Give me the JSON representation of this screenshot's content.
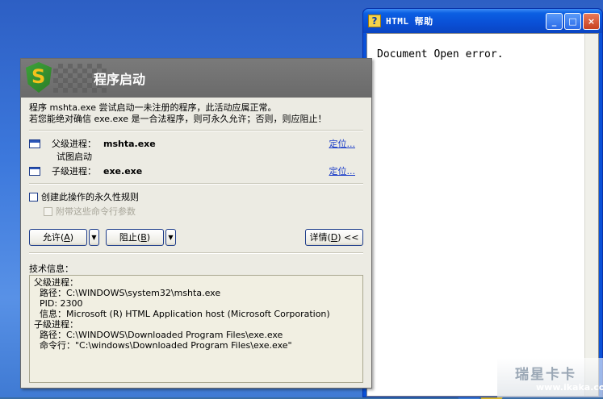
{
  "help_window": {
    "title": "HTML 帮助",
    "icon_glyph": "?",
    "body_text": "Document Open error.",
    "buttons": {
      "minimize": "_",
      "maximize": "□",
      "close": "×"
    }
  },
  "dialog": {
    "title": "程序启动",
    "desc_line1": "程序 mshta.exe 尝试启动一未注册的程序，此活动应属正常。",
    "desc_line2": "若您能绝对确信 exe.exe 是一合法程序，则可永久允许；否则，则应阻止！",
    "parent_label": "父级进程：",
    "parent_name": "mshta.exe",
    "tried_text": "试图启动",
    "child_label": "子级进程：",
    "child_name": "exe.exe",
    "locate_label": "定位...",
    "checkbox_permanent": "创建此操作的永久性规则",
    "checkbox_args": "附带这些命令行参数",
    "allow_label": "允许",
    "allow_key": "A",
    "block_label": "阻止",
    "block_key": "B",
    "details_label": "详情",
    "details_key": "D",
    "details_suffix": " <<",
    "tech_label": "技术信息：",
    "tech_lines": [
      "父级进程：",
      "  路径：C:\\WINDOWS\\system32\\mshta.exe",
      "  PID: 2300",
      "  信息：Microsoft (R) HTML Application host (Microsoft Corporation)",
      "子级进程：",
      "  路径：C:\\WINDOWS\\Downloaded Program Files\\exe.exe",
      "  命令行：\"C:\\windows\\Downloaded Program Files\\exe.exe\""
    ]
  },
  "watermark": {
    "main": "瑞星卡卡",
    "sub": "www.ikaka.com"
  },
  "colors": {
    "desktop": "#3a6ea5",
    "xp_blue": "#0a51d8",
    "dialog_header": "#6a6a6a",
    "link": "#1a3cc8"
  }
}
